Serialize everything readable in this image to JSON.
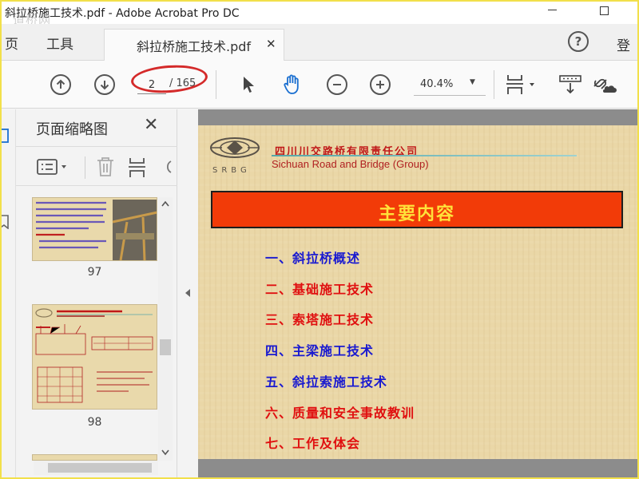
{
  "window": {
    "title": "斜拉桥施工技术.pdf - Adobe Acrobat Pro DC",
    "watermark": "道桥网"
  },
  "tabs": {
    "home_label": "页",
    "tools_label": "工具",
    "doc_tab_label": "斜拉桥施工技术.pdf",
    "signin_label": "登"
  },
  "toolbar": {
    "current_page": "2",
    "total_pages": "/ 165",
    "zoom": "40.4%",
    "annotation_color": "#d42a2a"
  },
  "thumbnails": {
    "panel_title": "页面缩略图",
    "pages": [
      {
        "label": "97"
      },
      {
        "label": "98"
      }
    ]
  },
  "document": {
    "company_name_cn": "四川川交路桥有限责任公司",
    "company_name_en": "Sichuan Road and Bridge (Group)",
    "logo_text": "SRBG",
    "heading": "主要内容",
    "heading_bg": "#f23b08",
    "heading_color": "#ffe23a",
    "items": [
      {
        "text": "一、斜拉桥概述",
        "color": "#1a1ad0"
      },
      {
        "text": "二、基础施工技术",
        "color": "#e01010"
      },
      {
        "text": "三、索塔施工技术",
        "color": "#e01010"
      },
      {
        "text": "四、主梁施工技术",
        "color": "#1a1ad0"
      },
      {
        "text": "五、斜拉索施工技术",
        "color": "#1a1ad0"
      },
      {
        "text": "六、质量和安全事故教训",
        "color": "#e01010"
      },
      {
        "text": "七、工作及体会",
        "color": "#e01010"
      }
    ]
  }
}
